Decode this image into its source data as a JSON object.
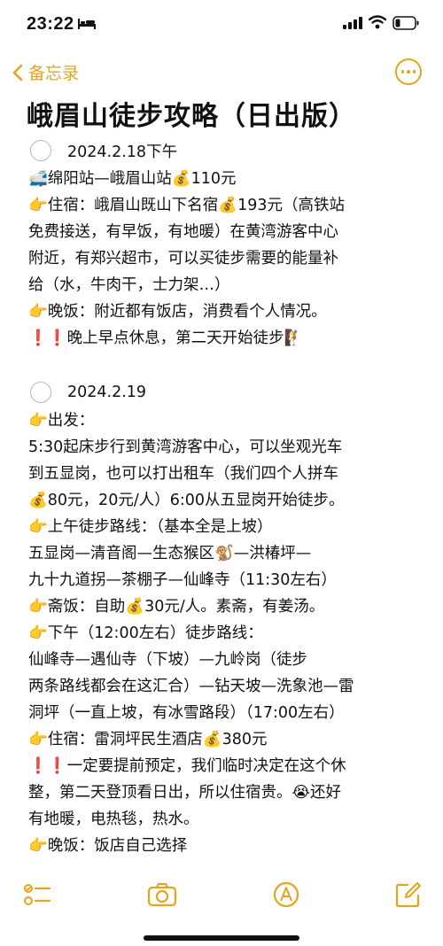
{
  "status": {
    "time": "23:22"
  },
  "nav": {
    "back_label": "备忘录"
  },
  "title": "峨眉山徒步攻略（日出版）",
  "sections": [
    {
      "date": "2024.2.18下午",
      "lines": [
        "🚅绵阳站—峨眉山站💰110元",
        "👉住宿：峨眉山既山下名宿💰193元（高铁站",
        "免费接送，有早饭，有地暖）在黄湾游客中心",
        "附近，有郑兴超市，可以买徒步需要的能量补",
        "给（水，牛肉干，士力架…）",
        "👉晚饭：附近都有饭店，消费看个人情况。",
        "❗❗晚上早点休息，第二天开始徒步🧗"
      ]
    },
    {
      "date": "2024.2.19",
      "lines": [
        "👉出发：",
        "5:30起床步行到黄湾游客中心，可以坐观光车",
        "到五显岗，也可以打出租车（我们四个人拼车",
        "💰80元，20元/人）6:00从五显岗开始徒步。",
        "👉上午徒步路线：（基本全是上坡）",
        "      五显岗—清音阁—生态猴区🐒—洪椿坪—",
        "九十九道拐—茶棚子—仙峰寺（11:30左右）",
        "👉斋饭：自助💰30元/人。素斋，有姜汤。",
        "👉下午（12:00左右）徒步路线：",
        "      仙峰寺—遇仙寺（下坡）—九岭岗（徒步",
        "两条路线都会在这汇合）—钻天坡—洗象池—雷",
        "洞坪（一直上坡，有冰雪路段）（17:00左右）",
        "👉住宿：雷洞坪民生酒店💰380元",
        "❗❗一定要提前预定，我们临时决定在这个休",
        "整，第二天登顶看日出，所以住宿贵。😭还好",
        "有地暖，电热毯，热水。",
        "👉晚饭：饭店自己选择"
      ]
    }
  ],
  "colors": {
    "accent": "#E5A41B",
    "text": "#111111"
  },
  "toolbar_icons": [
    "checklist-icon",
    "camera-icon",
    "markup-icon",
    "compose-icon"
  ]
}
